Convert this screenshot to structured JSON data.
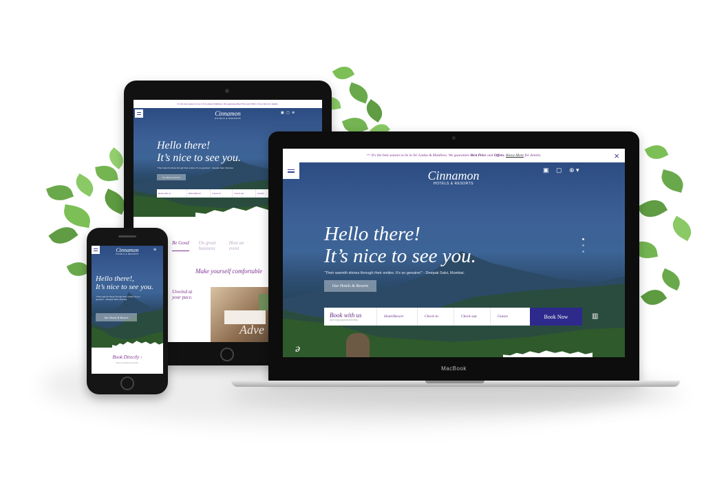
{
  "colors": {
    "brand_purple": "#6a2c88",
    "book_now_bg": "#2d2a8c",
    "promo_text": "#7a2f8e",
    "sky": "#3d6197"
  },
  "laptop": {
    "promo_text": "It's the best season to be in Sri Lanka & Maldives. We guarantee",
    "promo_best_price": "Best Price",
    "promo_and": "and",
    "promo_offers": "Offers.",
    "promo_know_more": "Know More",
    "promo_details": "for details.",
    "close_icon": "×",
    "logo_script": "Cinnamon",
    "logo_sub": "HOTELS & RESORTS",
    "hero_line1": "Hello there!",
    "hero_line2": "It’s nice to see you.",
    "quote": "“Their warmth shines through their smiles. It’s so genuine!” - Deepak Salvi, Mumbai.",
    "cta_button": "Our Hotels & Resorts",
    "booking": {
      "book_with_us": "Book with us",
      "book_with_us_sub": "And enjoy special benefits.",
      "hotel": "Hotel/Resort",
      "checkin": "Check-in",
      "checkout": "Check-out",
      "guests": "Guests",
      "book_now": "Book Now"
    },
    "brand_mark": "ə",
    "chin_label": "MacBook"
  },
  "tablet": {
    "promo_text": "It's the best season to be in Sri Lanka & Maldives. We guarantee Best Price and Offers. Know More for details.",
    "logo_script": "Cinnamon",
    "logo_sub": "HOTELS & RESORTS",
    "hero_line1": "Hello there!",
    "hero_line2": "It’s nice to see you.",
    "quote": "“Their warmth shines through their smiles. It’s so genuine!” - Deepak Salvi, Mumbai.",
    "cta_button": "Our Hotels & Resorts",
    "booking": {
      "book_with_us": "Book with us",
      "hotel": "Hotel/Resort",
      "checkin": "Check-in",
      "checkout": "Check-out",
      "guests": "Guests"
    },
    "tabs": [
      "Be Good",
      "On great business",
      "Host an event"
    ],
    "make_yourself": "Make yourself comfortable",
    "unwind_title": "Unwind at your pace.",
    "adventure": "Adve"
  },
  "phone": {
    "logo_script": "Cinnamon",
    "logo_sub": "HOTELS & RESORTS",
    "hero_line1": "Hello there!,",
    "hero_line2": "It’s nice to see you.",
    "quote": "“Their warmth shines through their smiles. It’s so genuine!” - Deepak Salvi, Mumbai.",
    "cta_button": "Our Hotels & Resorts",
    "book_directly": "Book Directly",
    "book_directly_sub": "Enjoy exclusive benefits."
  }
}
